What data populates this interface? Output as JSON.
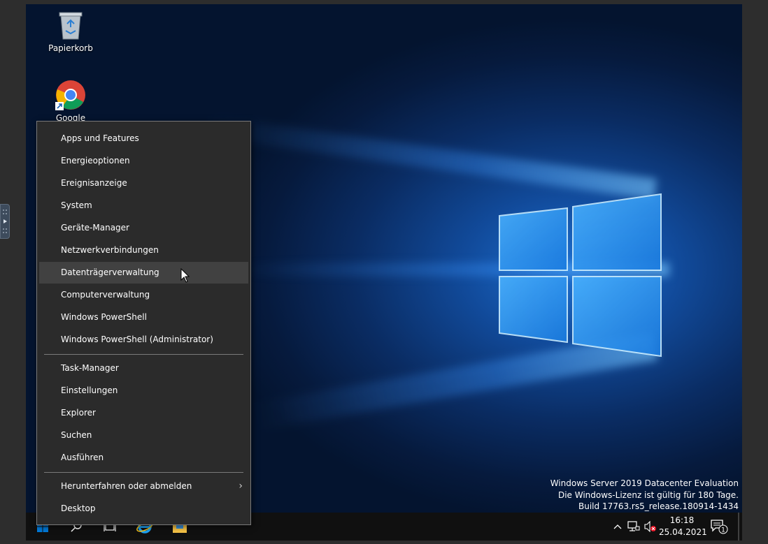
{
  "desktop": {
    "icons": [
      {
        "label": "Papierkorb",
        "icon": "recycle-bin-icon"
      },
      {
        "label": "Google Chrome",
        "icon": "chrome-icon"
      }
    ],
    "watermark": {
      "line1": "Windows Server 2019 Datacenter Evaluation",
      "line2": "Die Windows-Lizenz ist gültig für 180 Tage.",
      "line3": "Build 17763.rs5_release.180914-1434"
    }
  },
  "menu": {
    "group1": [
      "Apps und Features",
      "Energieoptionen",
      "Ereignisanzeige",
      "System",
      "Geräte-Manager",
      "Netzwerkverbindungen",
      "Datenträgerverwaltung",
      "Computerverwaltung",
      "Windows PowerShell",
      "Windows PowerShell (Administrator)"
    ],
    "group2": [
      "Task-Manager",
      "Einstellungen",
      "Explorer",
      "Suchen",
      "Ausführen"
    ],
    "group3": [
      "Herunterfahren oder abmelden",
      "Desktop"
    ],
    "hovered_item": "Datenträgerverwaltung"
  },
  "taskbar": {
    "clock_time": "16:18",
    "clock_date": "25.04.2021",
    "notification_count": "1"
  },
  "colors": {
    "menu_bg": "#2b2b2b",
    "menu_hover": "#414141",
    "taskbar_bg": "#101010",
    "accent": "#0078d7"
  }
}
